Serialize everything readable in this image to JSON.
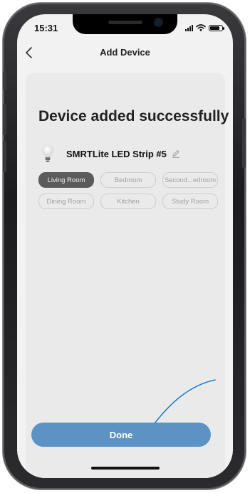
{
  "status_bar": {
    "time": "15:31"
  },
  "nav": {
    "title": "Add Device"
  },
  "main": {
    "headline": "Device added successfully",
    "device": {
      "name": "SMRTLite LED Strip #5",
      "icon": "light-bulb-icon"
    },
    "rooms": [
      {
        "label": "Living Room",
        "selected": true
      },
      {
        "label": "Bedroom",
        "selected": false
      },
      {
        "label": "Second...edroom",
        "selected": false
      },
      {
        "label": "Dining Room",
        "selected": false
      },
      {
        "label": "Kitchen",
        "selected": false
      },
      {
        "label": "Study Room",
        "selected": false
      }
    ],
    "done_label": "Done"
  },
  "colors": {
    "accent": "#5c93c5",
    "chip_selected": "#5b5b5b",
    "arrow": "#1e7fd6"
  }
}
